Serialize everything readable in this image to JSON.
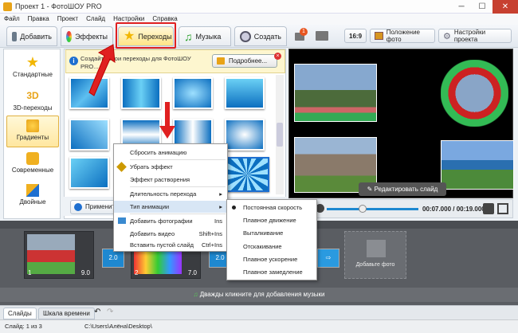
{
  "window": {
    "title": "Проект 1 - ФотоШОУ PRO"
  },
  "menu": [
    "Файл",
    "Правка",
    "Проект",
    "Слайд",
    "Настройки",
    "Справка"
  ],
  "tabs": [
    {
      "label": "Добавить"
    },
    {
      "label": "Эффекты"
    },
    {
      "label": "Переходы"
    },
    {
      "label": "Музыка"
    },
    {
      "label": "Создать"
    }
  ],
  "toolbar_right": {
    "badge": "1",
    "ratio": "16:9",
    "photo_pos": "Положение фото",
    "project_settings": "Настройки проекта"
  },
  "categories": [
    {
      "label": "Стандартные"
    },
    {
      "label": "3D-переходы"
    },
    {
      "label": "Градиенты"
    },
    {
      "label": "Современные"
    },
    {
      "label": "Двойные"
    }
  ],
  "info": {
    "text": "Создайте свои переходы для ФотоШОУ PRO...",
    "more": "Подробнее..."
  },
  "apply_label": "Применить",
  "edit_slide": "Редактировать слайд",
  "time": "00:07.000 / 00:19.000",
  "context_menu": {
    "items": [
      {
        "label": "Сбросить анимацию",
        "shortcut": ""
      },
      {
        "label": "Убрать эффект",
        "shortcut": ""
      },
      {
        "label": "Эффект растворения",
        "shortcut": ""
      },
      {
        "label": "Длительность перехода",
        "shortcut": "▸"
      },
      {
        "label": "Тип анимации",
        "shortcut": "▸"
      },
      {
        "label": "Добавить фотографии",
        "shortcut": "Ins"
      },
      {
        "label": "Добавить видео",
        "shortcut": "Shift+Ins"
      },
      {
        "label": "Вставить пустой слайд",
        "shortcut": "Ctrl+Ins"
      }
    ]
  },
  "submenu": {
    "items": [
      {
        "label": "Постоянная скорость"
      },
      {
        "label": "Плавное движение"
      },
      {
        "label": "Выталкивание"
      },
      {
        "label": "Отскакивание"
      },
      {
        "label": "Плавное ускорение"
      },
      {
        "label": "Плавное замедление"
      }
    ]
  },
  "timeline": {
    "slides": [
      {
        "num": "1",
        "dur": "9.0"
      },
      {
        "num": "2",
        "dur": "7.0"
      }
    ],
    "transitions": [
      "2.0",
      "2.0",
      "2.0"
    ],
    "add_photo": "Добавьте фото",
    "music_hint": "Дважды кликните для добавления музыки"
  },
  "bottom_tabs": [
    "Слайды",
    "Шкала времени"
  ],
  "status": {
    "slide": "Слайд: 1 из 3",
    "path": "C:\\Users\\Алёна\\Desktop\\"
  }
}
